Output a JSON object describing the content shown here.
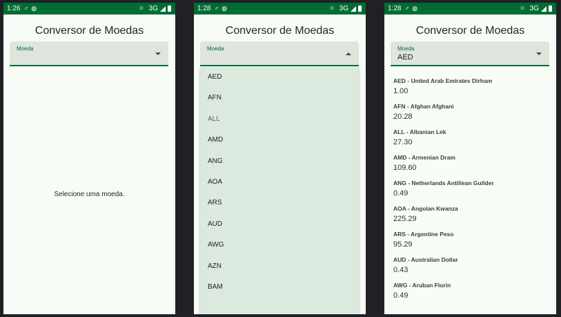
{
  "app": {
    "title": "Conversor de Moedas",
    "select_label": "Moeda"
  },
  "screens": [
    {
      "time": "1:26",
      "network": "3G",
      "selected": "",
      "empty_message": "Selecione uma moeda."
    },
    {
      "time": "1:28",
      "network": "3G",
      "selected": "",
      "options": [
        "AED",
        "AFN",
        "ALL",
        "AMD",
        "ANG",
        "AOA",
        "ARS",
        "AUD",
        "AWG",
        "AZN",
        "BAM"
      ]
    },
    {
      "time": "1:28",
      "network": "3G",
      "selected": "AED",
      "rates": [
        {
          "name": "AED - United Arab Emirates Dirham",
          "value": "1.00"
        },
        {
          "name": "AFN - Afghan Afghani",
          "value": "20.28"
        },
        {
          "name": "ALL - Albanian Lek",
          "value": "27.30"
        },
        {
          "name": "AMD - Armenian Dram",
          "value": "109.60"
        },
        {
          "name": "ANG - Netherlands Antillean Guilder",
          "value": "0.49"
        },
        {
          "name": "AOA - Angolan Kwanza",
          "value": "225.29"
        },
        {
          "name": "ARS - Argentine Peso",
          "value": "95.29"
        },
        {
          "name": "AUD - Australian Dollar",
          "value": "0.43"
        },
        {
          "name": "AWG - Aruban Florin",
          "value": "0.49"
        }
      ]
    }
  ],
  "colors": {
    "status_bar": "#006c35",
    "accent": "#006c35",
    "background": "#f8fcf6",
    "field_bg": "#dde5dc",
    "menu_bg": "#dce9df"
  },
  "icons": [
    "notification-icon",
    "sync-icon",
    "location-icon",
    "signal-icon",
    "battery-icon",
    "dropdown-arrow-icon"
  ]
}
